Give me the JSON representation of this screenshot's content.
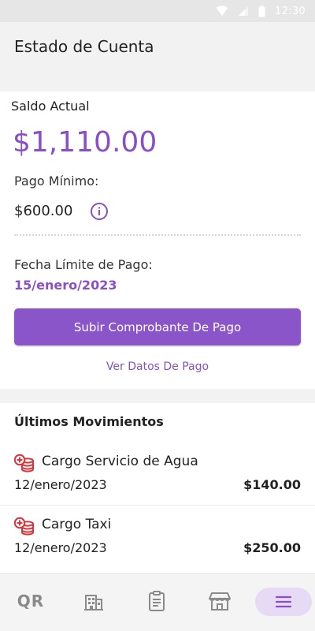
{
  "status_bar": {
    "time": "12:30"
  },
  "app_bar": {
    "title": "Estado de Cuenta"
  },
  "balance": {
    "label": "Saldo Actual",
    "amount": "$1,110.00",
    "min_label": "Pago Mínimo:",
    "min_amount": "$600.00",
    "due_label": "Fecha Límite de Pago:",
    "due_date": "15/enero/2023",
    "upload_button": "Subir Comprobante De Pago",
    "view_link": "Ver Datos De Pago"
  },
  "movements": {
    "title": "Últimos Movimientos",
    "items": [
      {
        "name": "Cargo Servicio de Agua",
        "date": "12/enero/2023",
        "amount": "$140.00",
        "icon": "coins-add-icon"
      },
      {
        "name": "Cargo Taxi",
        "date": "12/enero/2023",
        "amount": "$250.00",
        "icon": "coins-add-icon"
      }
    ]
  },
  "bottom_nav": {
    "qr_label": "QR",
    "items": [
      "qr-icon",
      "building-icon",
      "clipboard-icon",
      "store-icon",
      "menu-icon"
    ],
    "active": "menu-icon"
  },
  "colors": {
    "accent": "#8a4fc6",
    "button": "#8a55c9",
    "icon_red": "#d9343a",
    "active_nav_bg": "#e6daf4"
  }
}
